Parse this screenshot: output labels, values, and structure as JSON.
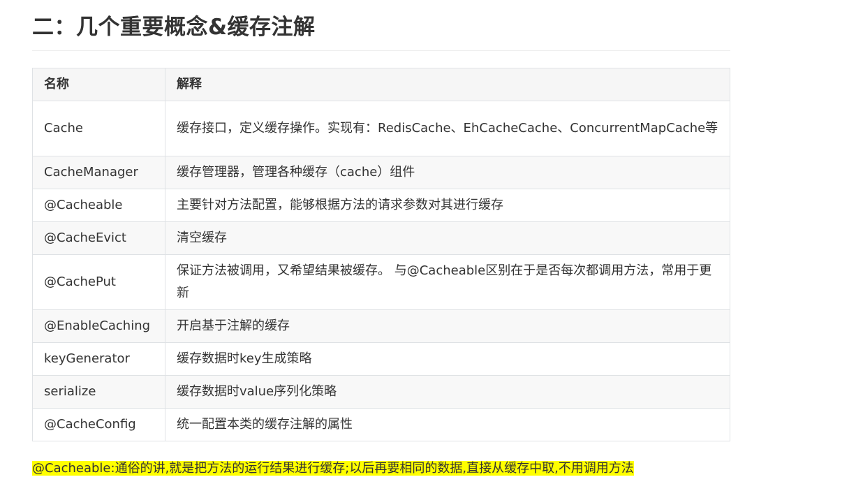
{
  "section": {
    "title": "二：几个重要概念&缓存注解"
  },
  "table": {
    "headers": [
      "名称",
      "解释"
    ],
    "rows": [
      {
        "name": "Cache",
        "desc": "缓存接口，定义缓存操作。实现有：RedisCache、EhCacheCache、ConcurrentMapCache等"
      },
      {
        "name": "CacheManager",
        "desc": "缓存管理器，管理各种缓存（cache）组件"
      },
      {
        "name": "@Cacheable",
        "desc": "主要针对方法配置，能够根据方法的请求参数对其进行缓存"
      },
      {
        "name": "@CacheEvict",
        "desc": "清空缓存"
      },
      {
        "name": "@CachePut",
        "desc": "保证方法被调用，又希望结果被缓存。 与@Cacheable区别在于是否每次都调用方法，常用于更新"
      },
      {
        "name": "@EnableCaching",
        "desc": "开启基于注解的缓存"
      },
      {
        "name": "keyGenerator",
        "desc": "缓存数据时key生成策略"
      },
      {
        "name": "serialize",
        "desc": "缓存数据时value序列化策略"
      },
      {
        "name": "@CacheConfig",
        "desc": "统一配置本类的缓存注解的属性"
      }
    ]
  },
  "note": {
    "text": "@Cacheable:通俗的讲,就是把方法的运行结果进行缓存;以后再要相同的数据,直接从缓存中取,不用调用方法",
    "highlight_color": "#ffff00"
  }
}
